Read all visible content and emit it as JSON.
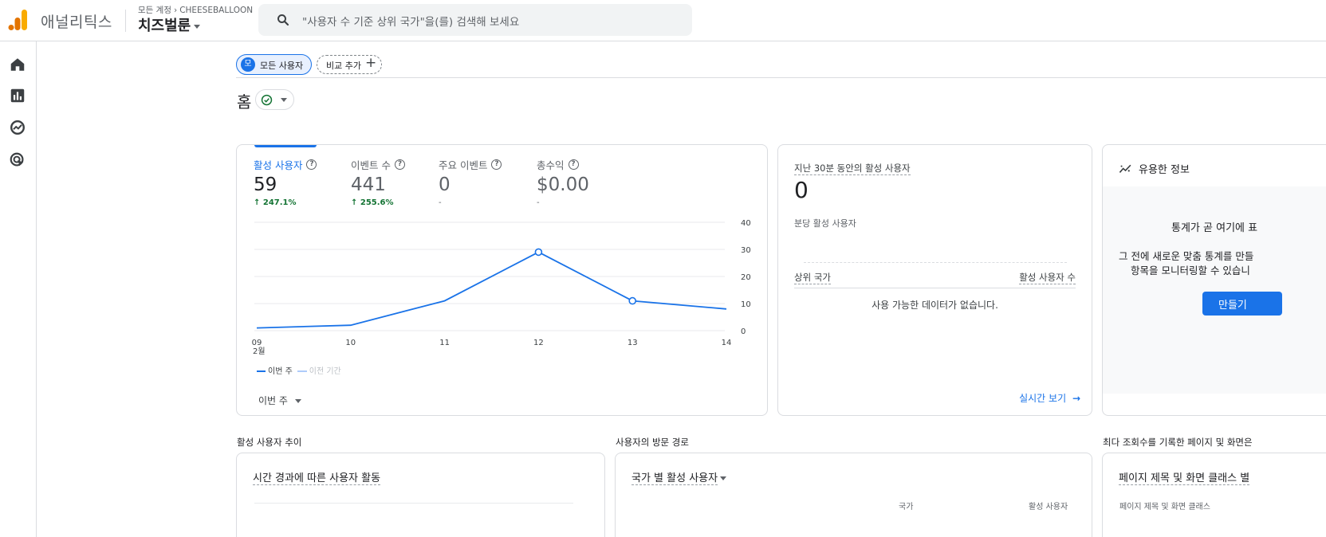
{
  "header": {
    "app_name": "애널리틱스",
    "breadcrumb_root": "모든 계정",
    "breadcrumb_account": "CHEESEBALLOON",
    "property_name": "치즈벌룬",
    "search_placeholder": "\"사용자 수 기준 상위 국가\"을(를) 검색해 보세요"
  },
  "nav": {
    "items": [
      "home-icon",
      "reports-icon",
      "explore-icon",
      "advertising-icon"
    ]
  },
  "comparison": {
    "segment_avatar": "모",
    "segment_label": "모든 사용자",
    "add_label": "비교 추가"
  },
  "page": {
    "title": "홈"
  },
  "overview_card": {
    "metrics": [
      {
        "label": "활성 사용자",
        "value": "59",
        "change": "247.1%"
      },
      {
        "label": "이벤트 수",
        "value": "441",
        "change": "255.6%"
      },
      {
        "label": "주요 이벤트",
        "value": "0",
        "change": "-"
      },
      {
        "label": "총수익",
        "value": "$0.00",
        "change": "-"
      }
    ],
    "legend_current": "이번 주",
    "legend_previous": "이전 기간",
    "period_label": "이번 주",
    "month_label": "2월"
  },
  "chart_data": {
    "type": "line",
    "x": [
      "09",
      "10",
      "11",
      "12",
      "13",
      "14"
    ],
    "series": [
      {
        "name": "이번 주",
        "values": [
          1,
          2,
          11,
          29,
          11,
          8
        ]
      }
    ],
    "y_ticks": [
      "40",
      "30",
      "20",
      "10",
      "0"
    ],
    "ylim": [
      0,
      40
    ],
    "grid": true
  },
  "realtime_card": {
    "title": "지난 30분 동안의 활성 사용자",
    "value": "0",
    "per_minute_label": "분당 활성 사용자",
    "col_left": "상위 국가",
    "col_right": "활성 사용자 수",
    "empty_text": "사용 가능한 데이터가 없습니다.",
    "link": "실시간 보기"
  },
  "insights_card": {
    "title": "유용한 정보",
    "line1": "통계가 곧 여기에 표",
    "line2": "그 전에 새로운 맞춤 통계를 만들",
    "line3": "항목을 모니터링할 수 있습니",
    "button": "만들기"
  },
  "lower_sections": {
    "s1_title": "활성 사용자 추이",
    "s1_card_title": "시간 경과에 따른 사용자 활동",
    "s2_title": "사용자의 방문 경로",
    "s2_card_title": "국가 별 활성 사용자",
    "s2_col_left": "국가",
    "s2_col_right": "활성 사용자",
    "s3_title": "최다 조회수를 기록한 페이지 및 화면은",
    "s3_card_title": "페이지 제목 및 화면 클래스 별",
    "s3_col": "페이지 제목 및 화면 클래스"
  },
  "colors": {
    "accent": "#1a73e8",
    "positive": "#137333",
    "logo_orange": "#f9ab00",
    "logo_dark": "#e37400"
  }
}
